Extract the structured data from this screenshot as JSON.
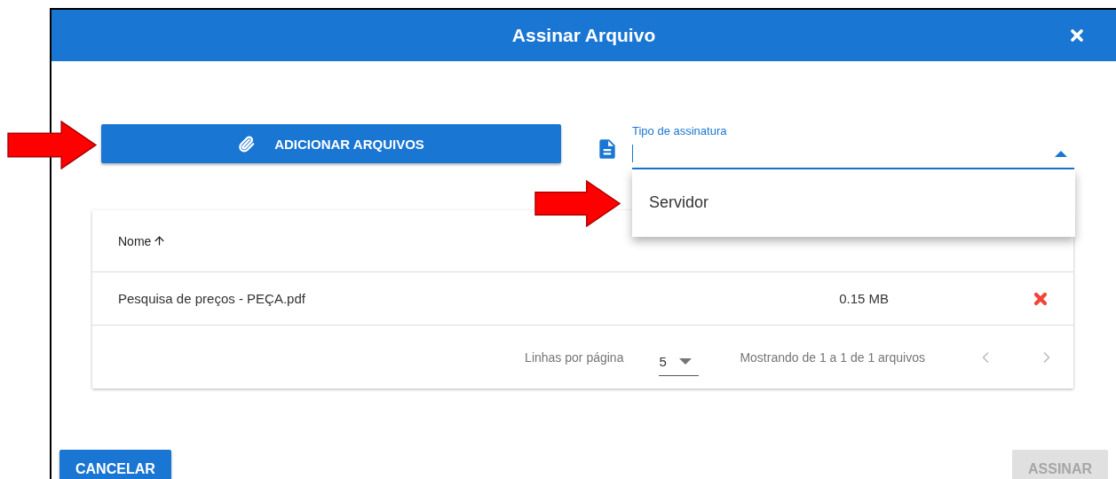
{
  "dialog": {
    "title": "Assinar Arquivo"
  },
  "add_files_button": {
    "label": "ADICIONAR ARQUIVOS"
  },
  "signature_type": {
    "label": "Tipo de assinatura",
    "expanded": true,
    "options": [
      {
        "label": "Servidor"
      }
    ]
  },
  "table": {
    "columns": [
      {
        "label": "Nome",
        "sort_ascending": true
      }
    ],
    "rows": [
      {
        "name": "Pesquisa de preços - PEÇA.pdf",
        "size": "0.15 MB"
      }
    ],
    "pagination": {
      "rows_per_page_label": "Linhas por página",
      "rows_per_page": "5",
      "range": "Mostrando de 1 a 1 de 1 arquivos",
      "prev_disabled": true,
      "next_disabled": true
    }
  },
  "buttons": [
    {
      "label": "CANCELAR",
      "disabled": false
    },
    {
      "label": "ASSINAR",
      "disabled": true
    }
  ]
}
